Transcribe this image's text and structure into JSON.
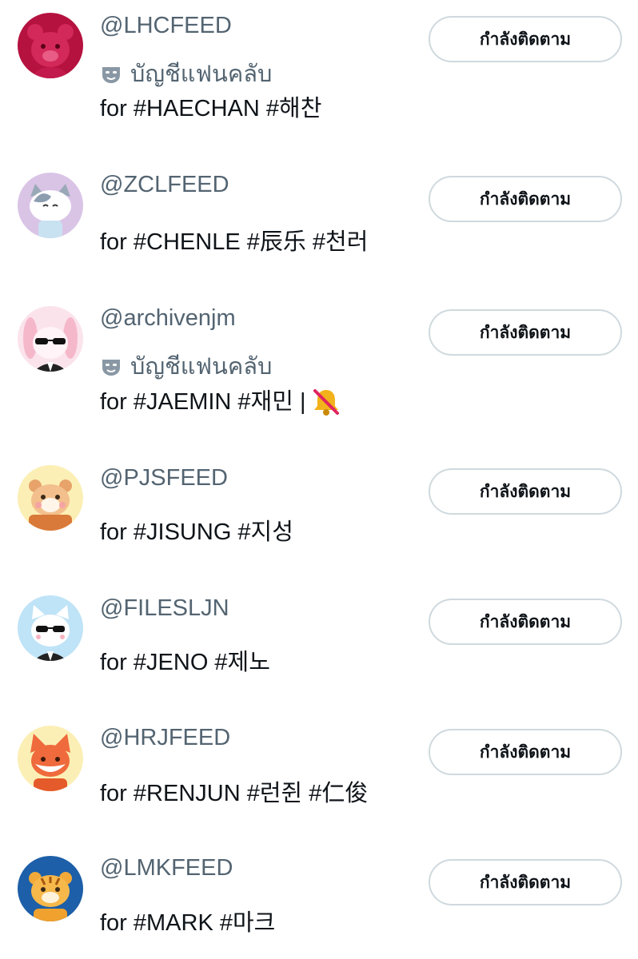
{
  "following_button_label": "กำลังติดตาม",
  "fanclub_label": "บัญชีแฟนคลับ",
  "accounts": [
    {
      "handle": "@LHCFEED",
      "fanclub": true,
      "bio": "for #HAECHAN #해찬",
      "avatar": "red-bear-avatar"
    },
    {
      "handle": "@ZCLFEED",
      "fanclub": false,
      "bio": "for #CHENLE #辰乐 #천러",
      "avatar": "gray-cat-avatar"
    },
    {
      "handle": "@archivenjm",
      "fanclub": true,
      "bio": "for #JAEMIN #재민 |",
      "bio_icon": "muted-bell-icon",
      "avatar": "pink-rabbit-sunglasses-avatar"
    },
    {
      "handle": "@PJSFEED",
      "fanclub": false,
      "bio": "for #JISUNG #지성",
      "avatar": "hamster-avatar"
    },
    {
      "handle": "@FILESLJN",
      "fanclub": false,
      "bio": "for #JENO #제노",
      "avatar": "white-cat-sunglasses-avatar"
    },
    {
      "handle": "@HRJFEED",
      "fanclub": false,
      "bio": "for #RENJUN #런쥔 #仁俊",
      "avatar": "fox-avatar"
    },
    {
      "handle": "@LMKFEED",
      "fanclub": false,
      "bio": "for #MARK #마크",
      "avatar": "tiger-avatar"
    }
  ],
  "colors": {
    "secondary_text": "#536471",
    "primary_text": "#0f1419",
    "button_border": "#cfd9de",
    "background": "#ffffff"
  }
}
